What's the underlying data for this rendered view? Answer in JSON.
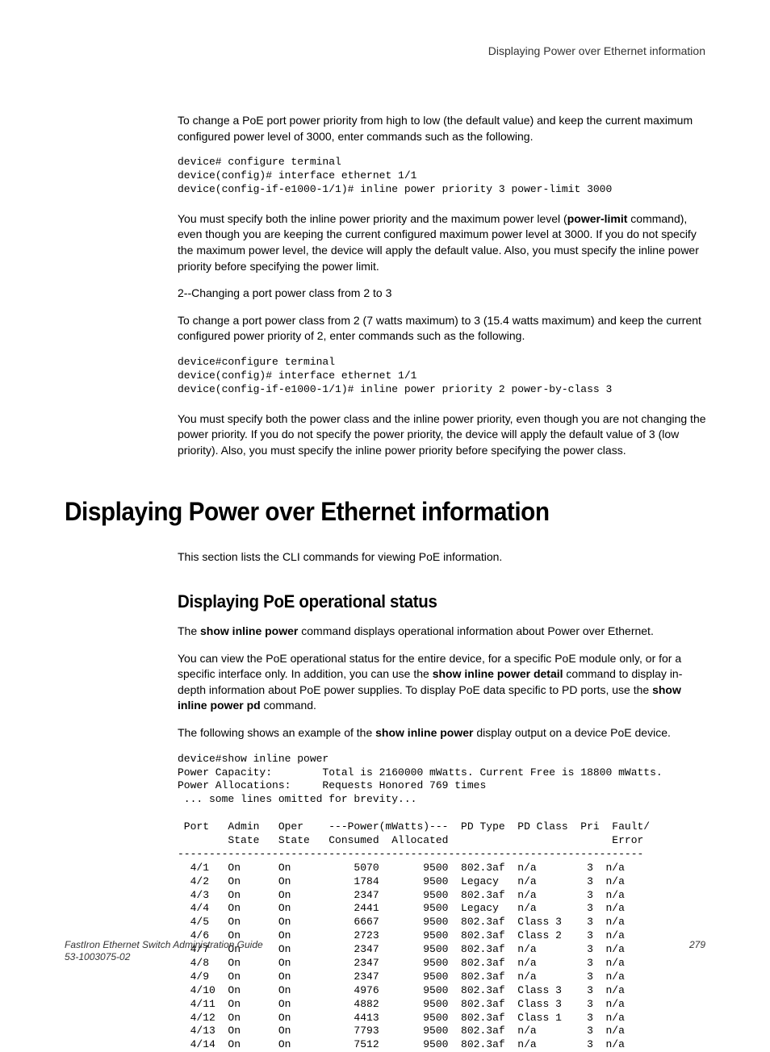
{
  "header": {
    "right": "Displaying Power over Ethernet information"
  },
  "intro_para": "To change a PoE port power priority from high to low (the default value) and keep the current maximum configured power level of 3000, enter commands such as the following.",
  "code1": "device# configure terminal\ndevice(config)# interface ethernet 1/1\ndevice(config-if-e1000-1/1)# inline power priority 3 power-limit 3000",
  "para2_pre": "You must specify both the inline power priority and the maximum power level (",
  "para2_bold": "power-limit",
  "para2_post": " command), even though you are keeping the current configured maximum power level at 3000. If you do not specify the maximum power level, the device will apply the default value. Also, you must specify the inline power priority before specifying the power limit.",
  "para3": "2--Changing a port power class from 2 to 3",
  "para4": "To change a port power class from 2 (7 watts maximum) to 3 (15.4 watts maximum) and keep the current configured power priority of 2, enter commands such as the following.",
  "code2": "device#configure terminal\ndevice(config)# interface ethernet 1/1\ndevice(config-if-e1000-1/1)# inline power priority 2 power-by-class 3",
  "para5": "You must specify both the power class and the inline power priority, even though you are not changing the power priority. If you do not specify the power priority, the device will apply the default value of 3 (low priority). Also, you must specify the inline power priority before specifying the power class.",
  "h1": "Displaying Power over Ethernet information",
  "section1_para": "This section lists the CLI commands for viewing PoE information.",
  "h2": "Displaying PoE operational status",
  "sec2_para1_pre": "The ",
  "sec2_para1_bold": "show inline power",
  "sec2_para1_post": " command displays operational information about Power over Ethernet.",
  "sec2_para2_a": "You can view the PoE operational status for the entire device, for a specific PoE module only, or for a specific interface only. In addition, you can use the ",
  "sec2_para2_bold1": "show inline power detail",
  "sec2_para2_b": " command to display in-depth information about PoE power supplies. To display PoE data specific to PD ports, use the ",
  "sec2_para2_bold2": "show inline power pd",
  "sec2_para2_c": " command.",
  "sec2_para3_a": "The following shows an example of the ",
  "sec2_para3_bold": "show inline power",
  "sec2_para3_b": " display output on a device PoE device.",
  "code3": "device#show inline power\nPower Capacity:        Total is 2160000 mWatts. Current Free is 18800 mWatts.\nPower Allocations:     Requests Honored 769 times\n ... some lines omitted for brevity...\n\n Port   Admin   Oper    ---Power(mWatts)---  PD Type  PD Class  Pri  Fault/\n        State   State   Consumed  Allocated                          Error\n--------------------------------------------------------------------------\n  4/1   On      On          5070       9500  802.3af  n/a        3  n/a\n  4/2   On      On          1784       9500  Legacy   n/a        3  n/a\n  4/3   On      On          2347       9500  802.3af  n/a        3  n/a\n  4/4   On      On          2441       9500  Legacy   n/a        3  n/a\n  4/5   On      On          6667       9500  802.3af  Class 3    3  n/a\n  4/6   On      On          2723       9500  802.3af  Class 2    3  n/a\n  4/7   On      On          2347       9500  802.3af  n/a        3  n/a\n  4/8   On      On          2347       9500  802.3af  n/a        3  n/a\n  4/9   On      On          2347       9500  802.3af  n/a        3  n/a\n  4/10  On      On          4976       9500  802.3af  Class 3    3  n/a\n  4/11  On      On          4882       9500  802.3af  Class 3    3  n/a\n  4/12  On      On          4413       9500  802.3af  Class 1    3  n/a\n  4/13  On      On          7793       9500  802.3af  n/a        3  n/a\n  4/14  On      On          7512       9500  802.3af  n/a        3  n/a",
  "footer": {
    "title": "FastIron Ethernet Switch Administration Guide",
    "docnum": "53-1003075-02",
    "page": "279"
  }
}
